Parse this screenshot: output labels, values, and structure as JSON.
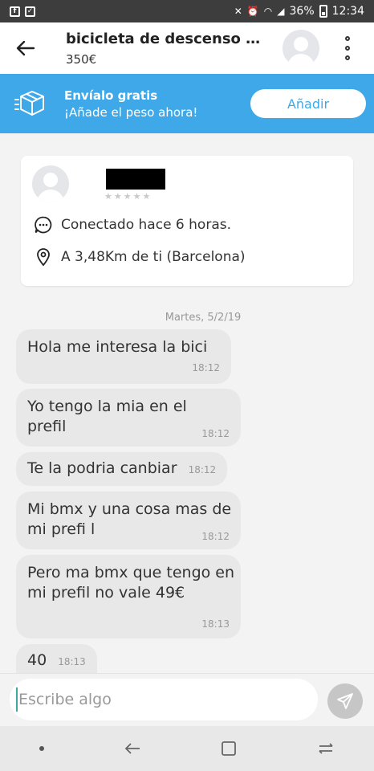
{
  "status_bar": {
    "battery_percent": "36%",
    "time": "12:34"
  },
  "header": {
    "title": "bicicleta de descenso ba...",
    "price": "350€"
  },
  "banner": {
    "title": "Envíalo gratis",
    "subtitle": "¡Añade el peso ahora!",
    "button_label": "Añadir"
  },
  "user_card": {
    "online_status": "Conectado hace 6 horas.",
    "location": "A 3,48Km de ti (Barcelona)",
    "rating_stars": 0
  },
  "chat": {
    "date": "Martes, 5/2/19",
    "messages": [
      {
        "text": "Hola me interesa la bici",
        "time": "18:12"
      },
      {
        "text": "Yo tengo la mia en el prefil",
        "time": "18:12"
      },
      {
        "text": "Te la podria canbiar",
        "time": "18:12"
      },
      {
        "text": "Mi bmx y una cosa mas de mi prefi l",
        "time": "18:12"
      },
      {
        "text": "Pero ma bmx que tengo en mi prefil no vale 49€",
        "time": "18:13"
      },
      {
        "text": "40",
        "time": "18:13"
      }
    ]
  },
  "input": {
    "placeholder": "Escribe algo"
  },
  "colors": {
    "banner": "#3ea8e8",
    "bubble": "#e8e8e8",
    "status_bar": "#3d3d3d"
  }
}
